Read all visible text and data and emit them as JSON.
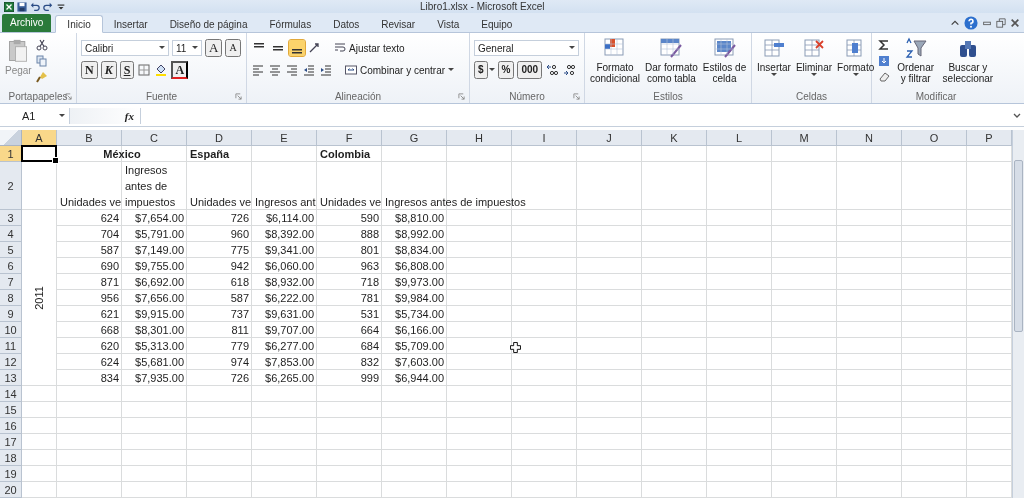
{
  "window": {
    "title": "Libro1.xlsx - Microsoft Excel"
  },
  "tabs": [
    {
      "label": "Archivo",
      "kind": "file",
      "selected": false
    },
    {
      "label": "Inicio",
      "kind": "tab",
      "selected": true
    },
    {
      "label": "Insertar",
      "kind": "tab",
      "selected": false
    },
    {
      "label": "Diseño de página",
      "kind": "tab",
      "selected": false
    },
    {
      "label": "Fórmulas",
      "kind": "tab",
      "selected": false
    },
    {
      "label": "Datos",
      "kind": "tab",
      "selected": false
    },
    {
      "label": "Revisar",
      "kind": "tab",
      "selected": false
    },
    {
      "label": "Vista",
      "kind": "tab",
      "selected": false
    },
    {
      "label": "Equipo",
      "kind": "tab",
      "selected": false
    }
  ],
  "ribbon": {
    "clipboard": {
      "label": "Portapapeles",
      "paste": "Pegar"
    },
    "font": {
      "label": "Fuente",
      "font_name": "Calibri",
      "font_size": "11",
      "grow": "A",
      "shrink": "A",
      "bold": "N",
      "italic": "K",
      "underline": "S",
      "font_color": "A"
    },
    "alignment": {
      "label": "Alineación",
      "vertical": [
        {
          "selected": false
        },
        {
          "selected": false
        },
        {
          "selected": true
        }
      ],
      "wrap_text": "Ajustar texto",
      "merge": "Combinar y centrar"
    },
    "number": {
      "label": "Número",
      "format": "General",
      "currency": "$",
      "percent": "%",
      "thousands": "000"
    },
    "styles": {
      "label": "Estilos",
      "buttons": [
        "Formato\ncondicional",
        "Dar formato\ncomo tabla",
        "Estilos de\ncelda"
      ]
    },
    "cells": {
      "label": "Celdas",
      "buttons": [
        "Insertar",
        "Eliminar",
        "Formato"
      ]
    },
    "editing": {
      "label": "Modificar",
      "buttons": [
        "Ordenar\ny filtrar",
        "Buscar y\nseleccionar"
      ]
    }
  },
  "formula_bar": {
    "name_box": "A1",
    "function_label": "fx"
  },
  "sheet": {
    "columns": [
      {
        "label": "A",
        "selected": true
      },
      {
        "label": "B",
        "selected": false
      },
      {
        "label": "C",
        "selected": false
      },
      {
        "label": "D",
        "selected": false
      },
      {
        "label": "E",
        "selected": false
      },
      {
        "label": "F",
        "selected": false
      },
      {
        "label": "G",
        "selected": false
      },
      {
        "label": "H",
        "selected": false
      },
      {
        "label": "I",
        "selected": false
      },
      {
        "label": "J",
        "selected": false
      },
      {
        "label": "K",
        "selected": false
      },
      {
        "label": "L",
        "selected": false
      },
      {
        "label": "M",
        "selected": false
      },
      {
        "label": "N",
        "selected": false
      },
      {
        "label": "O",
        "selected": false
      },
      {
        "label": "P",
        "selected": false
      }
    ],
    "rows": [
      {
        "label": "1",
        "selected": true,
        "cells": [
          null,
          {
            "text": "México",
            "kind": "title"
          },
          null,
          {
            "text": "España",
            "kind": "heading"
          },
          null,
          {
            "text": "Colombia",
            "kind": "heading"
          }
        ]
      },
      {
        "label": "2",
        "selected": false,
        "cells": [
          null,
          {
            "text": "Unidades ve",
            "kind": "text"
          },
          {
            "text": "Ingresos antes de impuestos",
            "kind": "wrap"
          },
          {
            "text": "Unidades ve",
            "kind": "text"
          },
          {
            "text": "Ingresos ant",
            "kind": "text"
          },
          {
            "text": "Unidades ve",
            "kind": "text"
          },
          {
            "text": "Ingresos antes de impuestos",
            "kind": "text"
          }
        ]
      },
      {
        "label": "3",
        "selected": false,
        "cells": [
          null,
          {
            "text": "624",
            "kind": "number"
          },
          {
            "text": "$7,654.00",
            "kind": "number"
          },
          {
            "text": "726",
            "kind": "number"
          },
          {
            "text": "$6,114.00",
            "kind": "number"
          },
          {
            "text": "590",
            "kind": "number"
          },
          {
            "text": "$8,810.00",
            "kind": "number"
          }
        ]
      },
      {
        "label": "4",
        "selected": false,
        "cells": [
          null,
          {
            "text": "704",
            "kind": "number"
          },
          {
            "text": "$5,791.00",
            "kind": "number"
          },
          {
            "text": "960",
            "kind": "number"
          },
          {
            "text": "$8,392.00",
            "kind": "number"
          },
          {
            "text": "888",
            "kind": "number"
          },
          {
            "text": "$8,992.00",
            "kind": "number"
          }
        ]
      },
      {
        "label": "5",
        "selected": false,
        "cells": [
          null,
          {
            "text": "587",
            "kind": "number"
          },
          {
            "text": "$7,149.00",
            "kind": "number"
          },
          {
            "text": "775",
            "kind": "number"
          },
          {
            "text": "$9,341.00",
            "kind": "number"
          },
          {
            "text": "801",
            "kind": "number"
          },
          {
            "text": "$8,834.00",
            "kind": "number"
          }
        ]
      },
      {
        "label": "6",
        "selected": false,
        "cells": [
          null,
          {
            "text": "690",
            "kind": "number"
          },
          {
            "text": "$9,755.00",
            "kind": "number"
          },
          {
            "text": "942",
            "kind": "number"
          },
          {
            "text": "$6,060.00",
            "kind": "number"
          },
          {
            "text": "963",
            "kind": "number"
          },
          {
            "text": "$6,808.00",
            "kind": "number"
          }
        ]
      },
      {
        "label": "7",
        "selected": false,
        "cells": [
          null,
          {
            "text": "871",
            "kind": "number"
          },
          {
            "text": "$6,692.00",
            "kind": "number"
          },
          {
            "text": "618",
            "kind": "number"
          },
          {
            "text": "$8,932.00",
            "kind": "number"
          },
          {
            "text": "718",
            "kind": "number"
          },
          {
            "text": "$9,973.00",
            "kind": "number"
          }
        ]
      },
      {
        "label": "8",
        "selected": false,
        "cells": [
          {
            "text": "2011",
            "kind": "vertical"
          },
          {
            "text": "956",
            "kind": "number"
          },
          {
            "text": "$7,656.00",
            "kind": "number"
          },
          {
            "text": "587",
            "kind": "number"
          },
          {
            "text": "$6,222.00",
            "kind": "number"
          },
          {
            "text": "781",
            "kind": "number"
          },
          {
            "text": "$9,984.00",
            "kind": "number"
          }
        ]
      },
      {
        "label": "9",
        "selected": false,
        "cells": [
          null,
          {
            "text": "621",
            "kind": "number"
          },
          {
            "text": "$9,915.00",
            "kind": "number"
          },
          {
            "text": "737",
            "kind": "number"
          },
          {
            "text": "$9,631.00",
            "kind": "number"
          },
          {
            "text": "531",
            "kind": "number"
          },
          {
            "text": "$5,734.00",
            "kind": "number"
          }
        ]
      },
      {
        "label": "10",
        "selected": false,
        "cells": [
          null,
          {
            "text": "668",
            "kind": "number"
          },
          {
            "text": "$8,301.00",
            "kind": "number"
          },
          {
            "text": "811",
            "kind": "number"
          },
          {
            "text": "$9,707.00",
            "kind": "number"
          },
          {
            "text": "664",
            "kind": "number"
          },
          {
            "text": "$6,166.00",
            "kind": "number"
          }
        ]
      },
      {
        "label": "11",
        "selected": false,
        "cells": [
          null,
          {
            "text": "620",
            "kind": "number"
          },
          {
            "text": "$5,313.00",
            "kind": "number"
          },
          {
            "text": "779",
            "kind": "number"
          },
          {
            "text": "$6,277.00",
            "kind": "number"
          },
          {
            "text": "684",
            "kind": "number"
          },
          {
            "text": "$5,709.00",
            "kind": "number"
          }
        ]
      },
      {
        "label": "12",
        "selected": false,
        "cells": [
          null,
          {
            "text": "624",
            "kind": "number"
          },
          {
            "text": "$5,681.00",
            "kind": "number"
          },
          {
            "text": "974",
            "kind": "number"
          },
          {
            "text": "$7,853.00",
            "kind": "number"
          },
          {
            "text": "832",
            "kind": "number"
          },
          {
            "text": "$7,603.00",
            "kind": "number"
          }
        ]
      },
      {
        "label": "13",
        "selected": false,
        "cells": [
          null,
          {
            "text": "834",
            "kind": "number"
          },
          {
            "text": "$7,935.00",
            "kind": "number"
          },
          {
            "text": "726",
            "kind": "number"
          },
          {
            "text": "$6,265.00",
            "kind": "number"
          },
          {
            "text": "999",
            "kind": "number"
          },
          {
            "text": "$6,944.00",
            "kind": "number"
          }
        ]
      },
      {
        "label": "14",
        "selected": false,
        "cells": []
      },
      {
        "label": "15",
        "selected": false,
        "cells": []
      },
      {
        "label": "16",
        "selected": false,
        "cells": []
      },
      {
        "label": "17",
        "selected": false,
        "cells": []
      },
      {
        "label": "18",
        "selected": false,
        "cells": []
      },
      {
        "label": "19",
        "selected": false,
        "cells": []
      },
      {
        "label": "20",
        "selected": false,
        "cells": []
      }
    ]
  }
}
